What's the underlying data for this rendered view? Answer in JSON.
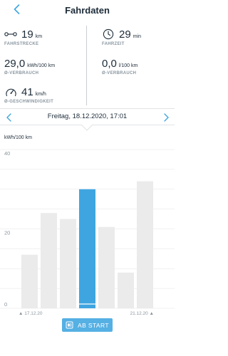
{
  "header": {
    "title": "Fahrdaten",
    "back_icon": "chevron-left-icon"
  },
  "stats": {
    "distance": {
      "value": "19",
      "unit": "km",
      "label": "FAHRSTRECKE",
      "icon": "route-icon"
    },
    "duration": {
      "value": "29",
      "unit": "min",
      "label": "FAHRZEIT",
      "icon": "clock-icon"
    },
    "energy": {
      "value": "29,0",
      "unit": "kWh/100 km",
      "label": "Ø-VERBRAUCH"
    },
    "fuel": {
      "value": "0,0",
      "unit": "l/100 km",
      "label": "Ø-VERBRAUCH"
    },
    "speed": {
      "value": "41",
      "unit": "km/h",
      "label": "Ø-GESCHWINDIGKEIT",
      "icon": "speedometer-icon"
    }
  },
  "date_nav": {
    "date": "Freitag, 18.12.2020, 17:01"
  },
  "chart_unit": "kWh/100 km",
  "chart_data": {
    "type": "bar",
    "ylabel": "kWh/100 km",
    "ylim": [
      0,
      40
    ],
    "yticks": [
      0,
      20,
      40
    ],
    "categories": [
      "",
      "",
      "",
      "",
      "",
      "",
      "",
      ""
    ],
    "x_start_label": "17.12.20",
    "x_end_label": "21.12.20",
    "values": [
      13.5,
      24,
      22.5,
      30,
      20.5,
      9,
      32,
      0
    ],
    "selected_index": 3,
    "colors": {
      "bar": "#ebebeb",
      "selected": "#3fa5e0",
      "grid": "#e3e3e3"
    }
  },
  "footer": {
    "button_label": "AB START",
    "button_icon": "car-reset-icon"
  },
  "colors": {
    "accent": "#3fa5e0",
    "text": "#1c2b38",
    "muted": "#8a96a0"
  }
}
